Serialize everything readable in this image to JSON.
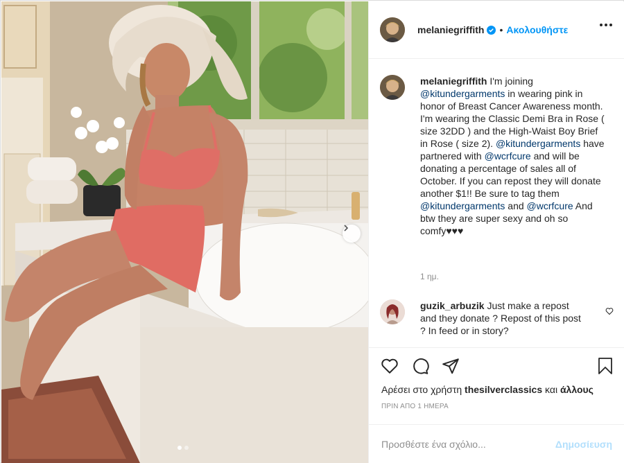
{
  "post": {
    "username": "melaniegriffith",
    "verified": true,
    "follow_label": "Ακολουθήστε",
    "separator": "•",
    "more_icon": "more-horizontal-icon"
  },
  "caption": {
    "username": "melaniegriffith",
    "segments": [
      {
        "type": "text",
        "text": " I'm joining "
      },
      {
        "type": "mention",
        "text": "@kitundergarments"
      },
      {
        "type": "text",
        "text": " in wearing pink in honor of Breast Cancer Awareness month. I'm wearing the Classic Demi Bra in Rose ( size 32DD ) and the High-Waist Boy Brief in Rose ( size 2). "
      },
      {
        "type": "mention",
        "text": "@kitundergarments"
      },
      {
        "type": "text",
        "text": " have partnered with "
      },
      {
        "type": "mention",
        "text": "@wcrfcure"
      },
      {
        "type": "text",
        "text": " and will be donating a percentage of sales all of October. If you can repost they will donate another $1!! Be sure to tag them "
      },
      {
        "type": "mention",
        "text": "@kitundergarments"
      },
      {
        "type": "text",
        "text": " and "
      },
      {
        "type": "mention",
        "text": "@wcrfcure"
      },
      {
        "type": "text",
        "text": " And btw they are super sexy and oh so comfy♥♥♥"
      }
    ],
    "time_ago": "1 ημ."
  },
  "comments": [
    {
      "username": "guzik_arbuzik",
      "text": " Just make a repost and they donate ? Repost of this post ? In feed or in story?"
    }
  ],
  "actions": {
    "icons": [
      "heart-icon",
      "comment-icon",
      "share-icon",
      "bookmark-icon"
    ],
    "liked_prefix": "Αρέσει στο χρήστη ",
    "liked_user": "thesilverclassics",
    "liked_middle": " και ",
    "liked_others": "άλλους",
    "date": "ΠΡΙΝ ΑΠΟ 1 ΗΜΕΡΑ"
  },
  "add_comment": {
    "placeholder": "Προσθέστε ένα σχόλιο...",
    "post_label": "Δημοσίευση"
  },
  "carousel": {
    "total": 2,
    "current": 1
  },
  "colors": {
    "accent": "#0095f6",
    "mention": "#00376b",
    "muted": "#8e8e8e",
    "post_disabled": "#b2dffc"
  }
}
